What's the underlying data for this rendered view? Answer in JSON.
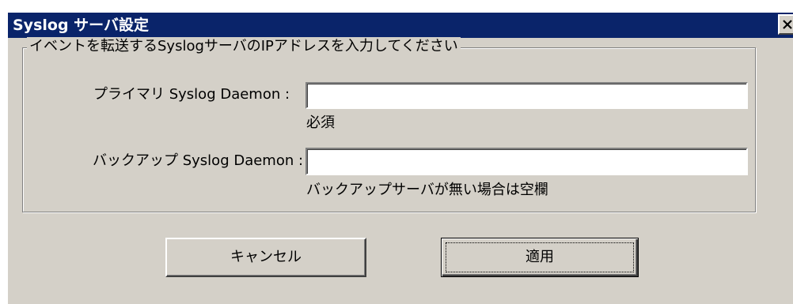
{
  "window": {
    "title": "Syslog サーバ設定",
    "close_label": "×"
  },
  "group": {
    "legend": "イベントを転送するSyslogサーバのIPアドレスを入力してください"
  },
  "primary": {
    "label": "プライマリ Syslog Daemon :",
    "value": "",
    "hint": "必須"
  },
  "backup": {
    "label": "バックアップ Syslog Daemon :",
    "value": "",
    "hint": "バックアップサーバが無い場合は空欄"
  },
  "buttons": {
    "cancel_label": "キャンセル",
    "apply_label": "適用"
  },
  "icons": {
    "close": "close-icon"
  },
  "colors": {
    "titlebar": "#0a246a",
    "dialog_face": "#d4d0c8"
  }
}
